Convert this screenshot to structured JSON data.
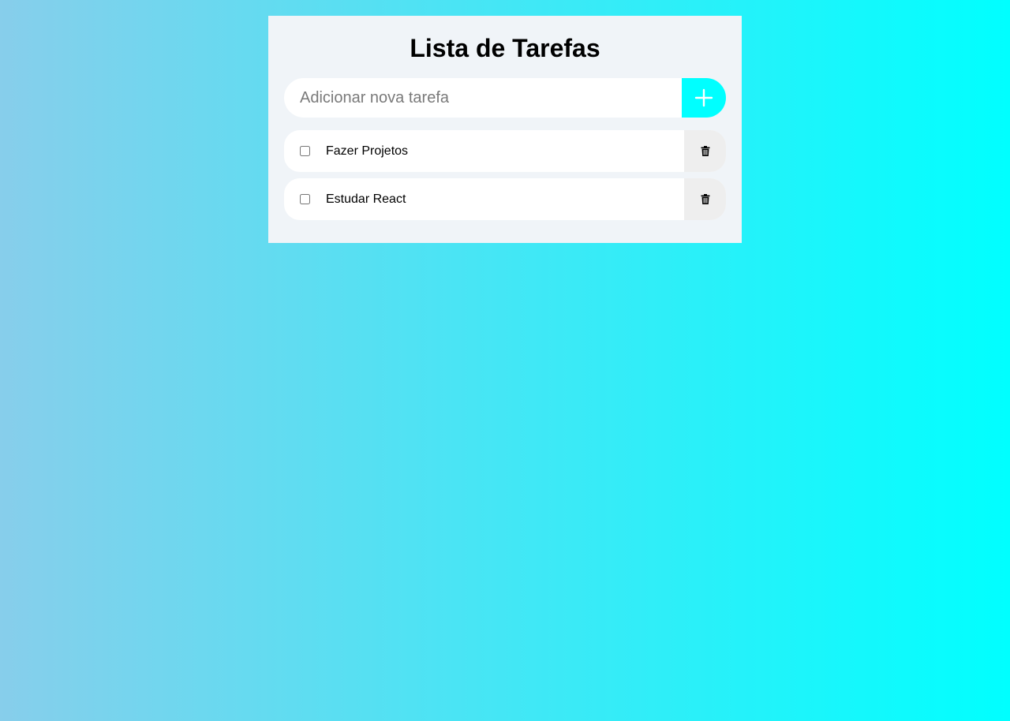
{
  "app": {
    "title": "Lista de Tarefas"
  },
  "new_task": {
    "value": "",
    "placeholder": "Adicionar nova tarefa",
    "add_icon": "plus-icon"
  },
  "tasks": [
    {
      "label": "Fazer Projetos",
      "done": false,
      "delete_icon": "trash-icon"
    },
    {
      "label": "Estudar React",
      "done": false,
      "delete_icon": "trash-icon"
    }
  ],
  "colors": {
    "background_gradient": [
      "#87ceeb",
      "#00ffff"
    ],
    "card": "#f0f4f8",
    "accent": "#00ffff",
    "delete_bg": "#eeeeee"
  }
}
